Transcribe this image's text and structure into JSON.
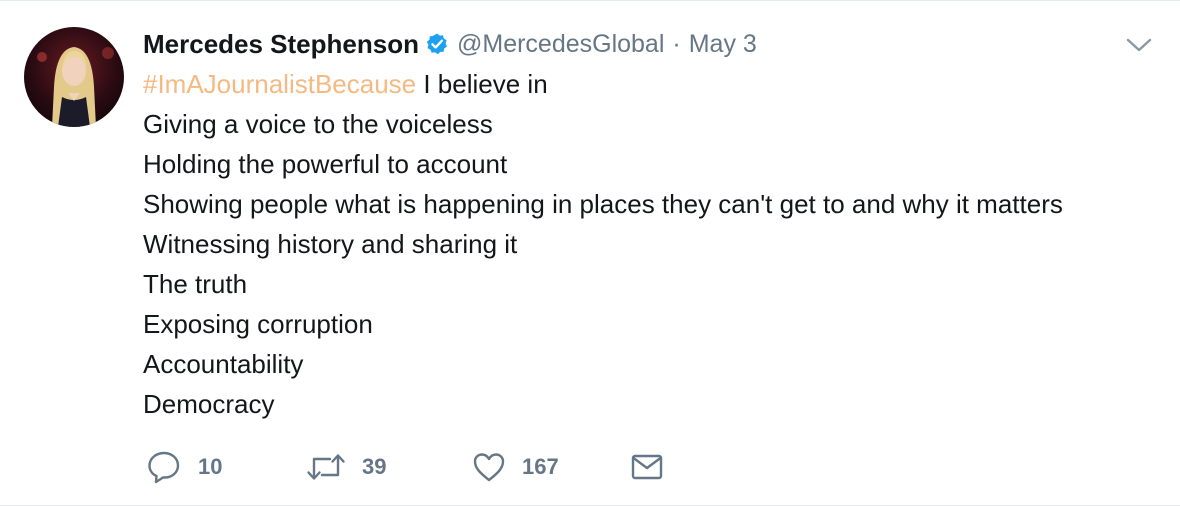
{
  "tweet": {
    "author_name": "Mercedes Stephenson",
    "handle": "@MercedesGlobal",
    "separator": "·",
    "date": "May 3",
    "hashtag": "#ImAJournalistBecause",
    "first_line_rest": " I believe in",
    "lines": [
      "Giving a voice to the voiceless",
      "Holding the powerful to account",
      "Showing people what is happening in places they can't get to and why it matters",
      "Witnessing history and sharing it",
      "The truth",
      "Exposing corruption",
      "Accountability",
      "Democracy"
    ],
    "actions": {
      "reply_count": "10",
      "retweet_count": "39",
      "like_count": "167"
    }
  },
  "colors": {
    "text": "#14171a",
    "secondary": "#657786",
    "hashtag": "#f5b982",
    "verified": "#1da1f2"
  },
  "icons": {
    "verified": "verified-badge-icon",
    "caret": "chevron-down-icon",
    "reply": "reply-icon",
    "retweet": "retweet-icon",
    "like": "heart-icon",
    "message": "envelope-icon"
  }
}
